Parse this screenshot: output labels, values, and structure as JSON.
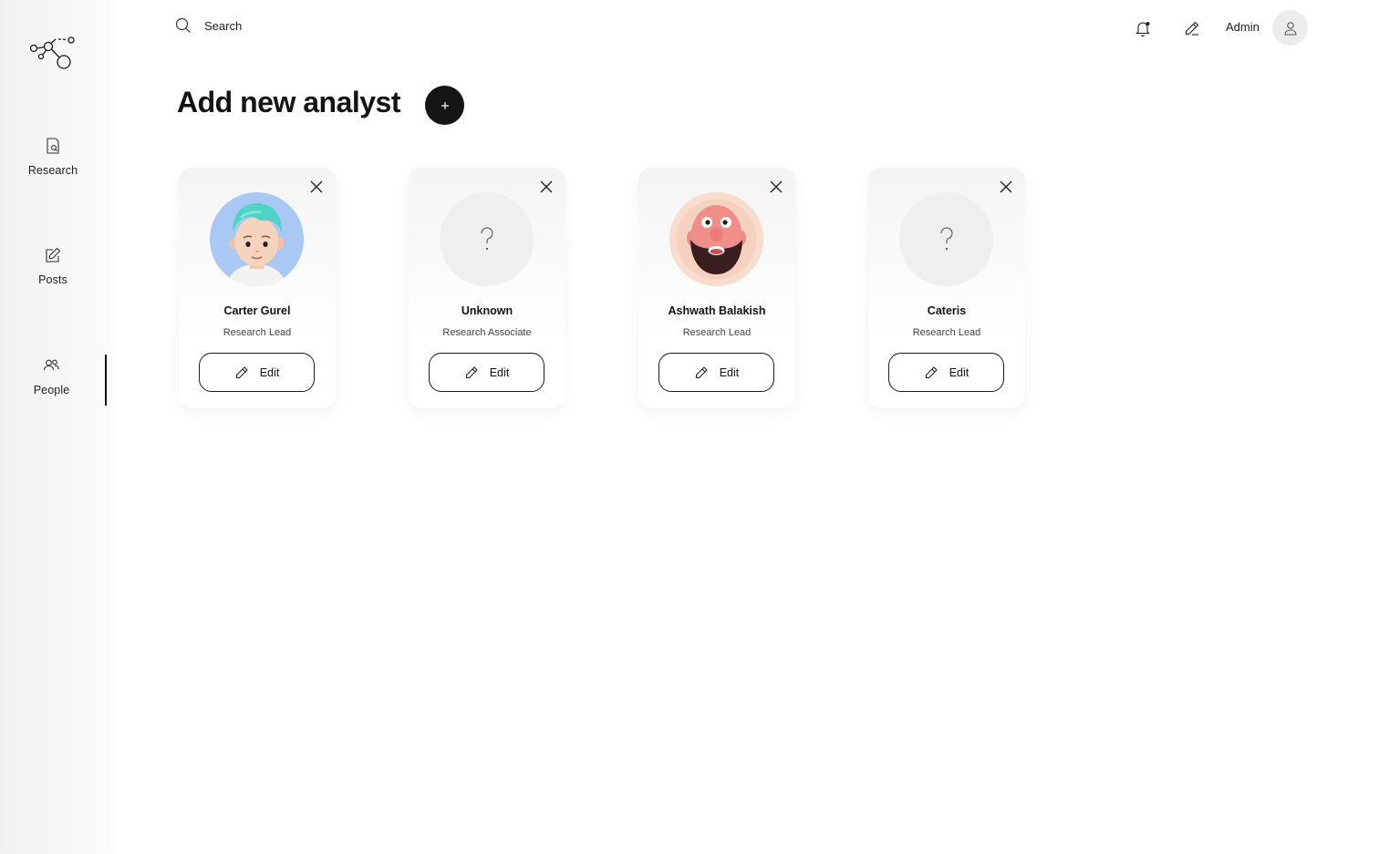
{
  "search": {
    "placeholder": "Search"
  },
  "header": {
    "admin_label": "Admin"
  },
  "sidebar": {
    "items": [
      {
        "label": "Research",
        "icon": "research-icon"
      },
      {
        "label": "Posts",
        "icon": "posts-icon"
      },
      {
        "label": "People",
        "icon": "people-icon",
        "active": true
      }
    ]
  },
  "main": {
    "title": "Add new analyst",
    "add_button_icon": "plus-icon",
    "cards": [
      {
        "name": "Carter Gurel",
        "role": "Research Lead",
        "edit_label": "Edit",
        "avatar": "cartoon-avatar-teal-hair"
      },
      {
        "name": "Unknown",
        "role": "Research Associate",
        "edit_label": "Edit",
        "avatar": "question-mark-placeholder"
      },
      {
        "name": "Ashwath Balakish",
        "role": "Research Lead",
        "edit_label": "Edit",
        "avatar": "cartoon-avatar-bearded-face"
      },
      {
        "name": "Cateris",
        "role": "Research Lead",
        "edit_label": "Edit",
        "avatar": "question-mark-placeholder"
      }
    ]
  },
  "colors": {
    "accent": "#151515",
    "sidebar_bg": "#f3f3f3",
    "placeholder_bg": "#efefef",
    "page_bg": "#ffffff"
  }
}
